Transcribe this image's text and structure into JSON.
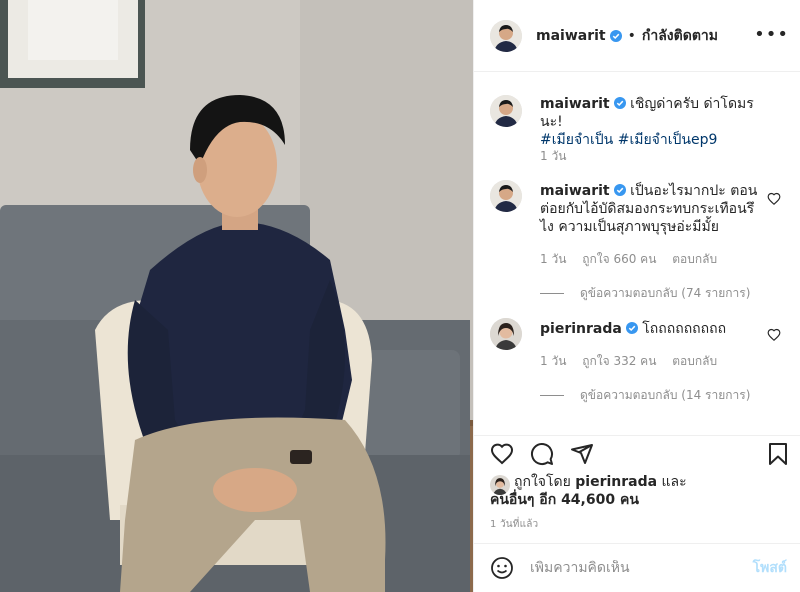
{
  "post": {
    "author": "maiwarit",
    "follow_status": "กำลังติดตาม",
    "more_icon": "ellipsis-icon",
    "caption": {
      "username": "maiwarit",
      "text": "เชิญด่าครับ ด่าโดมรนะ!",
      "hashtags": [
        "#เมียจำเป็น",
        "#เมียจำเป็นep9"
      ],
      "time": "1 วัน"
    },
    "comments": [
      {
        "username": "maiwarit",
        "text": "เป็นอะไรมากปะ ตอนต่อยกับไอ้บัดิสมองกระทบกระเทือนรึไง ความเป็นสุภาพบุรุษอ่ะมีมั้ย",
        "time": "1 วัน",
        "likes": "ถูกใจ 660 คน",
        "reply": "ตอบกลับ",
        "view_replies": "ดูข้อความตอบกลับ (74 รายการ)"
      },
      {
        "username": "pierinrada",
        "text": "โถถถถถถถถถ",
        "time": "1 วัน",
        "likes": "ถูกใจ 332 คน",
        "reply": "ตอบกลับ",
        "view_replies": "ดูข้อความตอบกลับ (14 รายการ)"
      }
    ],
    "liked_by": {
      "prefix": "ถูกใจโดย",
      "user": "pierinrada",
      "joiner": "และ",
      "others": "คนอื่นๆ อีก 44,600 คน"
    },
    "timestamp": "1 วันที่แล้ว",
    "add_comment": {
      "placeholder": "เพิ่มความคิดเห็น",
      "post_label": "โพสต์"
    }
  },
  "colors": {
    "verified": "#3897f0",
    "link": "#00376b",
    "post_button_disabled": "#b2dffc",
    "muted": "#8e8e8e"
  }
}
